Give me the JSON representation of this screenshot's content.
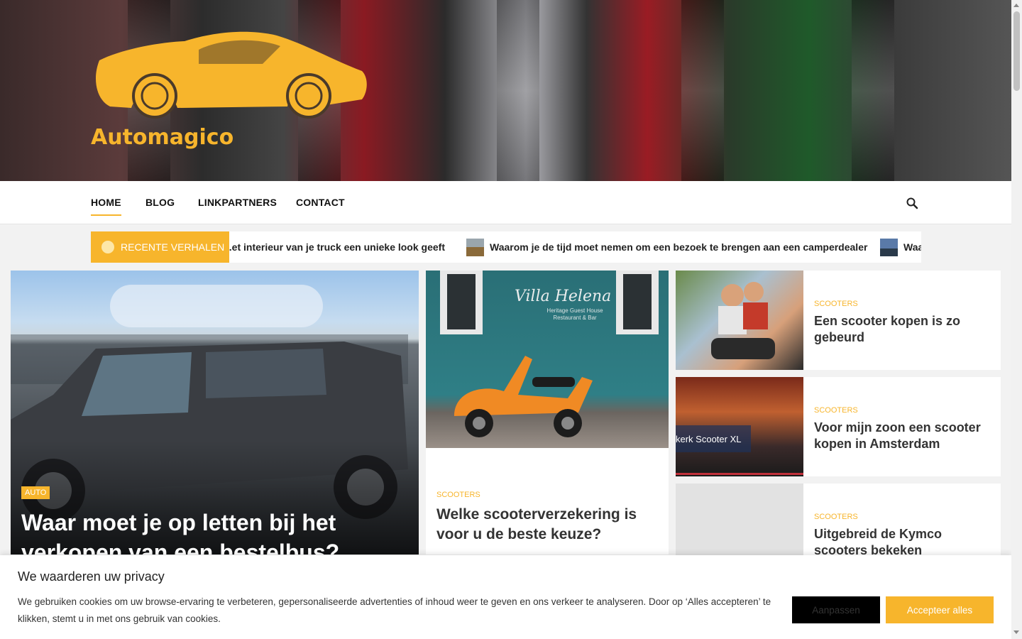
{
  "site": {
    "title": "Automagico"
  },
  "nav": {
    "items": [
      "HOME",
      "BLOG",
      "LINKPARTNERS",
      "CONTACT"
    ],
    "active": "HOME"
  },
  "ticker": {
    "label": "RECENTE VERHALEN",
    "items": [
      "...et interieur van je truck een unieke look geeft",
      "Waarom je de tijd moet nemen om een bezoek te brengen aan een camperdealer",
      "Waa..."
    ]
  },
  "hero": {
    "category": "AUTO",
    "title": "Waar moet je op letten bij het verkopen van een bestelbus?"
  },
  "middle": {
    "category": "SCOOTERS",
    "title": "Welke scooterverzekering is voor u de beste keuze?",
    "image_sign": "Villa Helena",
    "image_subsign": "Heritage Guest House\nRestaurant & Bar"
  },
  "side": [
    {
      "category": "SCOOTERS",
      "title": "Een scooter kopen is zo gebeurd"
    },
    {
      "category": "SCOOTERS",
      "title": "Voor mijn zoon een scooter kopen in Amsterdam",
      "image_overlay": "kerk Scooter XL"
    },
    {
      "category": "SCOOTERS",
      "title": "Uitgebreid de Kymco scooters bekeken"
    }
  ],
  "cookie": {
    "title": "We waarderen uw privacy",
    "text": "We gebruiken cookies om uw browse-ervaring te verbeteren, gepersonaliseerde advertenties of inhoud weer te geven en ons verkeer te analyseren. Door op ‘Alles accepteren’ te klikken, stemt u in met ons gebruik van cookies.",
    "customize_label": "Aanpassen",
    "accept_label": "Accepteer alles"
  },
  "colors": {
    "accent": "#f7b52c"
  }
}
